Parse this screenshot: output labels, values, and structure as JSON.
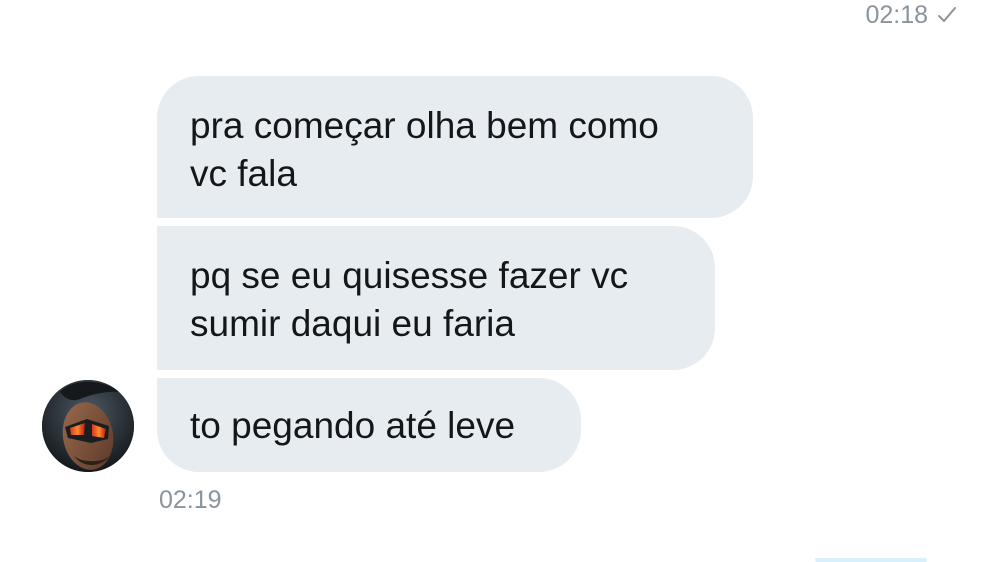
{
  "conversation": {
    "sent_status": {
      "time": "02:18",
      "icon": "check-icon"
    },
    "received_messages": [
      {
        "lines": [
          "pra começar olha bem como",
          "vc fala"
        ]
      },
      {
        "lines": [
          "pq se eu quisesse fazer vc",
          "sumir daqui eu faria"
        ]
      },
      {
        "lines": [
          "to pegando até leve"
        ]
      }
    ],
    "received_time": "02:19",
    "avatar": {
      "icon": "avatar-photo"
    }
  },
  "colors": {
    "bubble_background": "#e6ecf0",
    "muted_text": "#8a949e",
    "message_text": "#14171a"
  }
}
